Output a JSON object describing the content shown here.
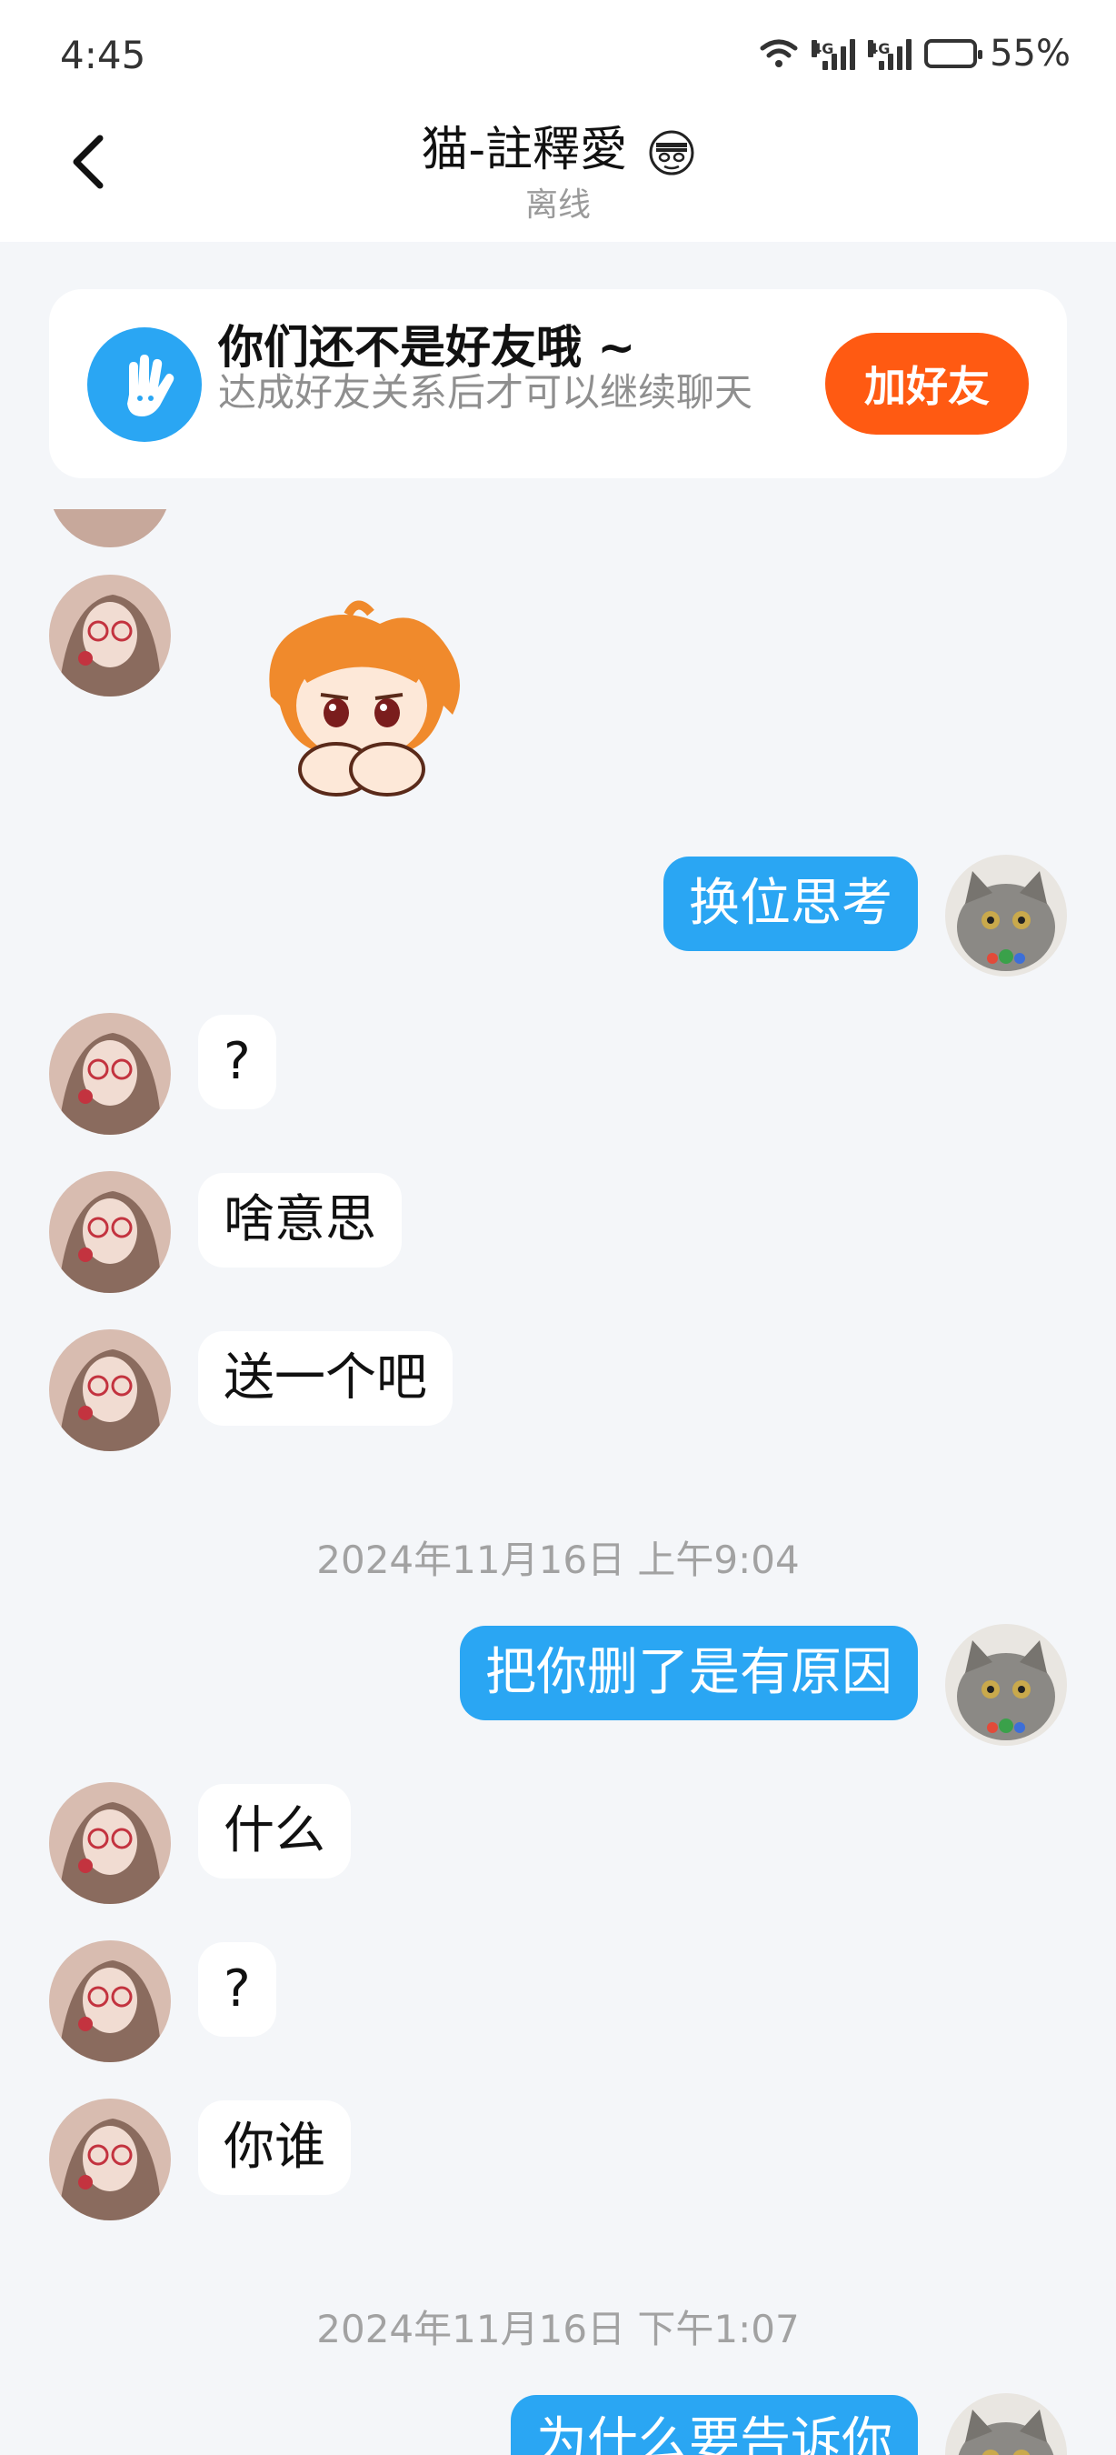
{
  "status_bar": {
    "time": "4:45",
    "network_1": "4G",
    "network_2": "4G",
    "battery": "55%"
  },
  "header": {
    "title": "猫-註釋愛",
    "status": "离线"
  },
  "friend_banner": {
    "title": "你们还不是好友哦 ~",
    "subtitle": "达成好友关系后才可以继续聊天",
    "button": "加好友"
  },
  "messages": [
    {
      "from": "peer",
      "type": "sticker",
      "text": ""
    },
    {
      "from": "me",
      "type": "text",
      "text": "换位思考"
    },
    {
      "from": "peer",
      "type": "text",
      "text": "?"
    },
    {
      "from": "peer",
      "type": "text",
      "text": "啥意思"
    },
    {
      "from": "peer",
      "type": "text",
      "text": "送一个吧"
    },
    {
      "from": "system",
      "type": "timestamp",
      "text": "2024年11月16日 上午9:04"
    },
    {
      "from": "me",
      "type": "text",
      "text": "把你删了是有原因"
    },
    {
      "from": "peer",
      "type": "text",
      "text": "什么"
    },
    {
      "from": "peer",
      "type": "text",
      "text": "?"
    },
    {
      "from": "peer",
      "type": "text",
      "text": "你谁"
    },
    {
      "from": "system",
      "type": "timestamp",
      "text": "2024年11月16日 下午1:07"
    },
    {
      "from": "me",
      "type": "text",
      "text": "为什么要告诉你"
    }
  ],
  "colors": {
    "accent": "#2aa6f3",
    "add_friend": "#ff5a12",
    "background": "#f4f6f9"
  }
}
